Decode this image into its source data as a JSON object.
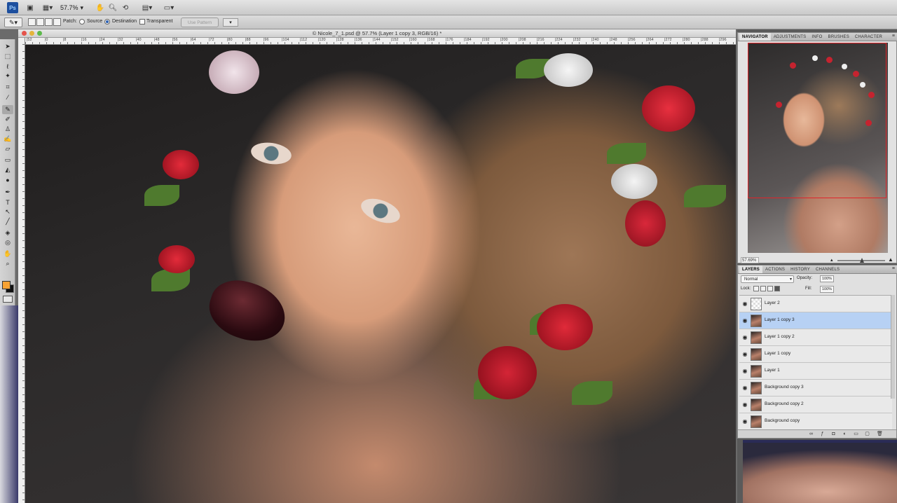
{
  "app": {
    "logo": "Ps",
    "zoom": "57.7%"
  },
  "options": {
    "patch_label": "Patch:",
    "source_label": "Source",
    "destination_label": "Destination",
    "transparent_label": "Transparent",
    "use_pattern_label": "Use Pattern"
  },
  "document": {
    "title": "© Nicole_7_1.psd @ 57.7% (Layer 1 copy 3, RGB/16) *",
    "ruler_ticks": [
      "|52",
      "|0",
      "|8",
      "|16",
      "|24",
      "|32",
      "|40",
      "|48",
      "|56",
      "|64",
      "|72",
      "|80",
      "|88",
      "|96",
      "|104",
      "|112",
      "|120",
      "|128",
      "|136",
      "|144",
      "|152",
      "|160",
      "|168",
      "|176",
      "|184",
      "|192",
      "|200",
      "|208",
      "|216",
      "|224",
      "|232",
      "|240",
      "|248",
      "|256",
      "|264",
      "|272",
      "|280",
      "|288",
      "|296"
    ]
  },
  "navigator": {
    "tabs": [
      "NAVIGATOR",
      "ADJUSTMENTS",
      "INFO",
      "BRUSHES",
      "CHARACTER"
    ],
    "zoom_value": "57.69%"
  },
  "layers_panel": {
    "tabs": [
      "LAYERS",
      "ACTIONS",
      "HISTORY",
      "CHANNELS"
    ],
    "blend_mode": "Normal",
    "opacity_label": "Opacity:",
    "opacity_value": "100%",
    "lock_label": "Lock:",
    "fill_label": "Fill:",
    "fill_value": "100%",
    "layers": [
      {
        "name": "Layer 2",
        "selected": false,
        "blank": true
      },
      {
        "name": "Layer 1 copy 3",
        "selected": true,
        "blank": false
      },
      {
        "name": "Layer 1 copy 2",
        "selected": false,
        "blank": false
      },
      {
        "name": "Layer 1 copy",
        "selected": false,
        "blank": false
      },
      {
        "name": "Layer 1",
        "selected": false,
        "blank": false
      },
      {
        "name": "Background copy 3",
        "selected": false,
        "blank": false
      },
      {
        "name": "Background copy 2",
        "selected": false,
        "blank": false
      },
      {
        "name": "Background copy",
        "selected": false,
        "blank": false
      }
    ]
  },
  "colors": {
    "foreground": "#f7a233",
    "background": "#111111",
    "selection": "#b7d1f4",
    "proxy_view": "#e0242a"
  }
}
